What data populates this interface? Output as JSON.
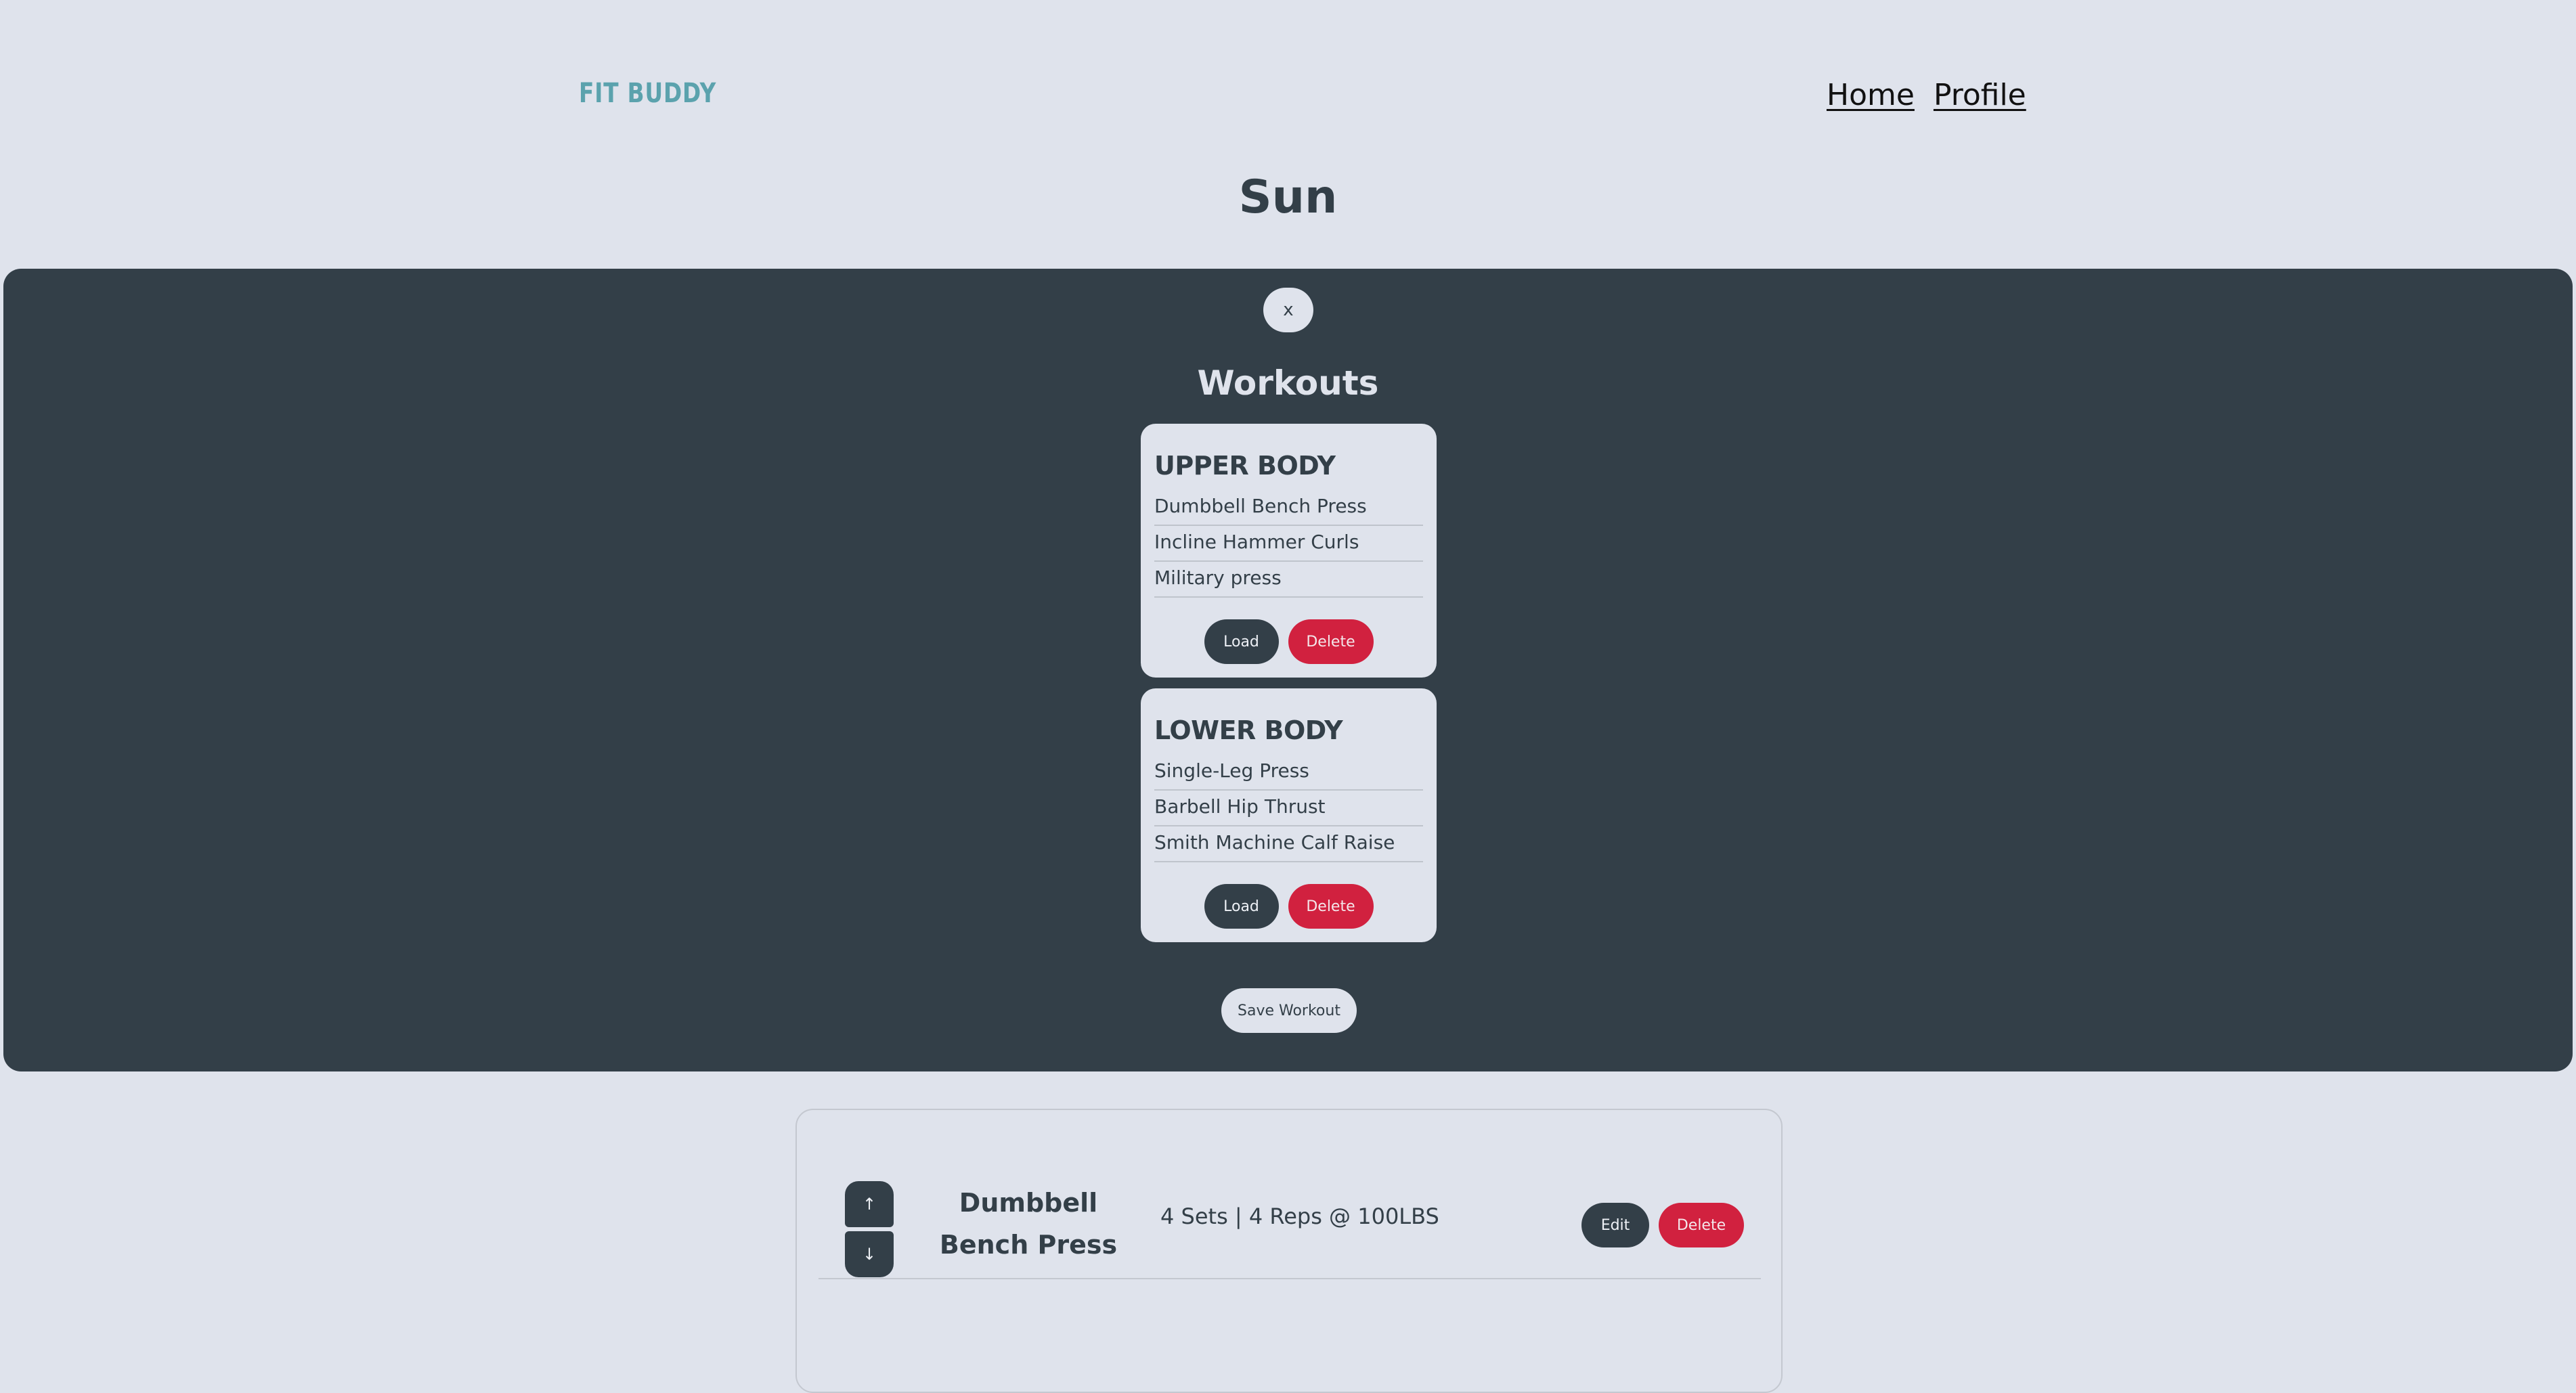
{
  "header": {
    "logo": "FIT BUDDY",
    "nav": {
      "home": "Home",
      "profile": "Profile"
    }
  },
  "day_title": "Sun",
  "modal": {
    "close_label": "x",
    "title": "Workouts",
    "workouts": [
      {
        "name": "UPPER BODY",
        "exercises": [
          "Dumbbell Bench Press",
          "Incline Hammer Curls",
          "Military press"
        ],
        "load_label": "Load",
        "delete_label": "Delete"
      },
      {
        "name": "LOWER BODY",
        "exercises": [
          "Single-Leg Press",
          "Barbell Hip Thrust",
          "Smith Machine Calf Raise"
        ],
        "load_label": "Load",
        "delete_label": "Delete"
      }
    ],
    "save_label": "Save Workout"
  },
  "exercise_panel": {
    "rows": [
      {
        "up_label": "↑",
        "down_label": "↓",
        "name": "Dumbbell Bench Press",
        "stats": "4 Sets | 4 Reps @ 100LBS",
        "edit_label": "Edit",
        "delete_label": "Delete"
      }
    ]
  },
  "colors": {
    "background": "#dfe3ec",
    "dark": "#333f48",
    "accent": "#5ba2ad",
    "danger": "#d1213f"
  }
}
